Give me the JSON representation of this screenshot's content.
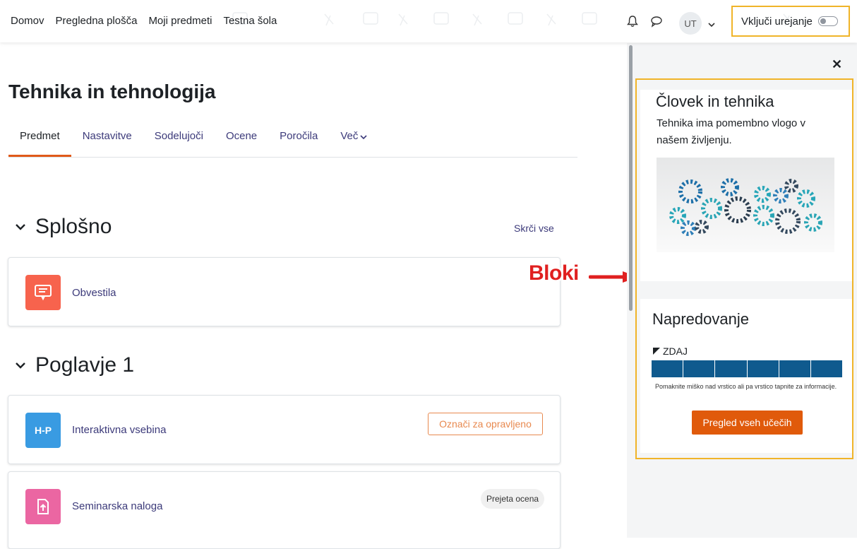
{
  "nav": {
    "links": [
      "Domov",
      "Pregledna plošča",
      "Moji predmeti",
      "Testna šola"
    ],
    "avatar_initials": "UT",
    "edit_mode_label": "Vključi urejanje"
  },
  "annotation": {
    "blocks_label": "Bloki",
    "arrow_color": "#e02020",
    "highlight_color": "#f0b429"
  },
  "course": {
    "title": "Tehnika in tehnologija",
    "tabs": [
      "Predmet",
      "Nastavitve",
      "Sodelujoči",
      "Ocene",
      "Poročila",
      "Več"
    ],
    "active_tab": "Predmet"
  },
  "sections": [
    {
      "title": "Splošno",
      "collapse_all_label": "Skrči vse",
      "activities": [
        {
          "name": "Obvestila",
          "icon": "forum-icon",
          "icon_color": "#f7634d"
        }
      ]
    },
    {
      "title": "Poglavje 1",
      "activities": [
        {
          "name": "Interaktivna vsebina",
          "icon": "h5p-icon",
          "icon_label": "H-P",
          "icon_color": "#399be2",
          "action_label": "Označi za opravljeno"
        },
        {
          "name": "Seminarska naloga",
          "icon": "assignment-icon",
          "icon_color": "#eb66a2",
          "badge_label": "Prejeta ocena"
        }
      ]
    }
  ],
  "drawer": {
    "blocks": [
      {
        "title": "Človek in tehnika",
        "text": "Tehnika ima pomembno vlogo v našem življenju."
      },
      {
        "title": "Napredovanje",
        "now_label": "ZDAJ",
        "progress_segments": 6,
        "progress_color": "#0f5a8e",
        "help_text": "Pomaknite miško nad vrstico ali pa vrstico tapnite za informacije.",
        "button_label": "Pregled vseh učečih",
        "button_color": "#e05a0b"
      }
    ]
  },
  "colors": {
    "accent": "#e05a1a",
    "link": "#3c3a7a"
  }
}
